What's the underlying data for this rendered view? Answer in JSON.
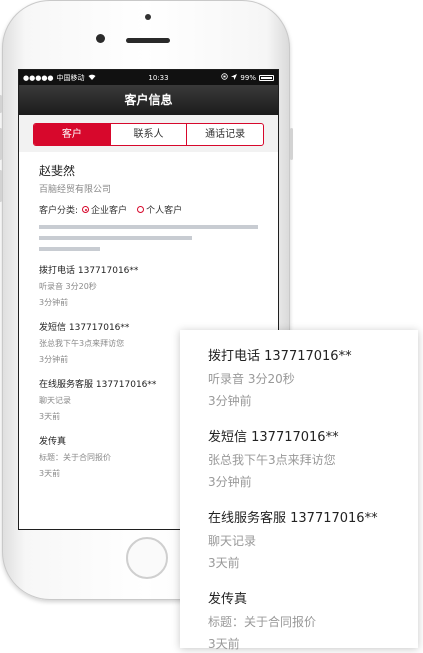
{
  "status_bar": {
    "signal": "●●●●●",
    "carrier": "中国移动",
    "wifi_icon": "wifi-icon",
    "time": "10:33",
    "location_icon": "location-icon",
    "battery_percent": "99%"
  },
  "nav": {
    "title": "客户信息"
  },
  "tabs": [
    {
      "label": "客户",
      "active": true
    },
    {
      "label": "联系人",
      "active": false
    },
    {
      "label": "通话记录",
      "active": false
    }
  ],
  "customer": {
    "name": "赵斐然",
    "company": "百脑经贸有限公司",
    "category_label": "客户分类:",
    "options": [
      {
        "label": "企业客户",
        "selected": true
      },
      {
        "label": "个人客户",
        "selected": false
      }
    ]
  },
  "activities": [
    {
      "title": "拨打电话 137717016**",
      "subtitle": "听录音 3分20秒",
      "time": "3分钟前"
    },
    {
      "title": "发短信 137717016**",
      "subtitle": "张总我下午3点来拜访您",
      "time": "3分钟前"
    },
    {
      "title": "在线服务客服 137717016**",
      "subtitle": "聊天记录",
      "time": "3天前"
    },
    {
      "title": "发传真",
      "subtitle": "标题：关于合同报价",
      "time": "3天前"
    }
  ],
  "colors": {
    "accent": "#d7082c",
    "navbar": "#262626",
    "placeholder_bar": "#c8ccd2"
  }
}
